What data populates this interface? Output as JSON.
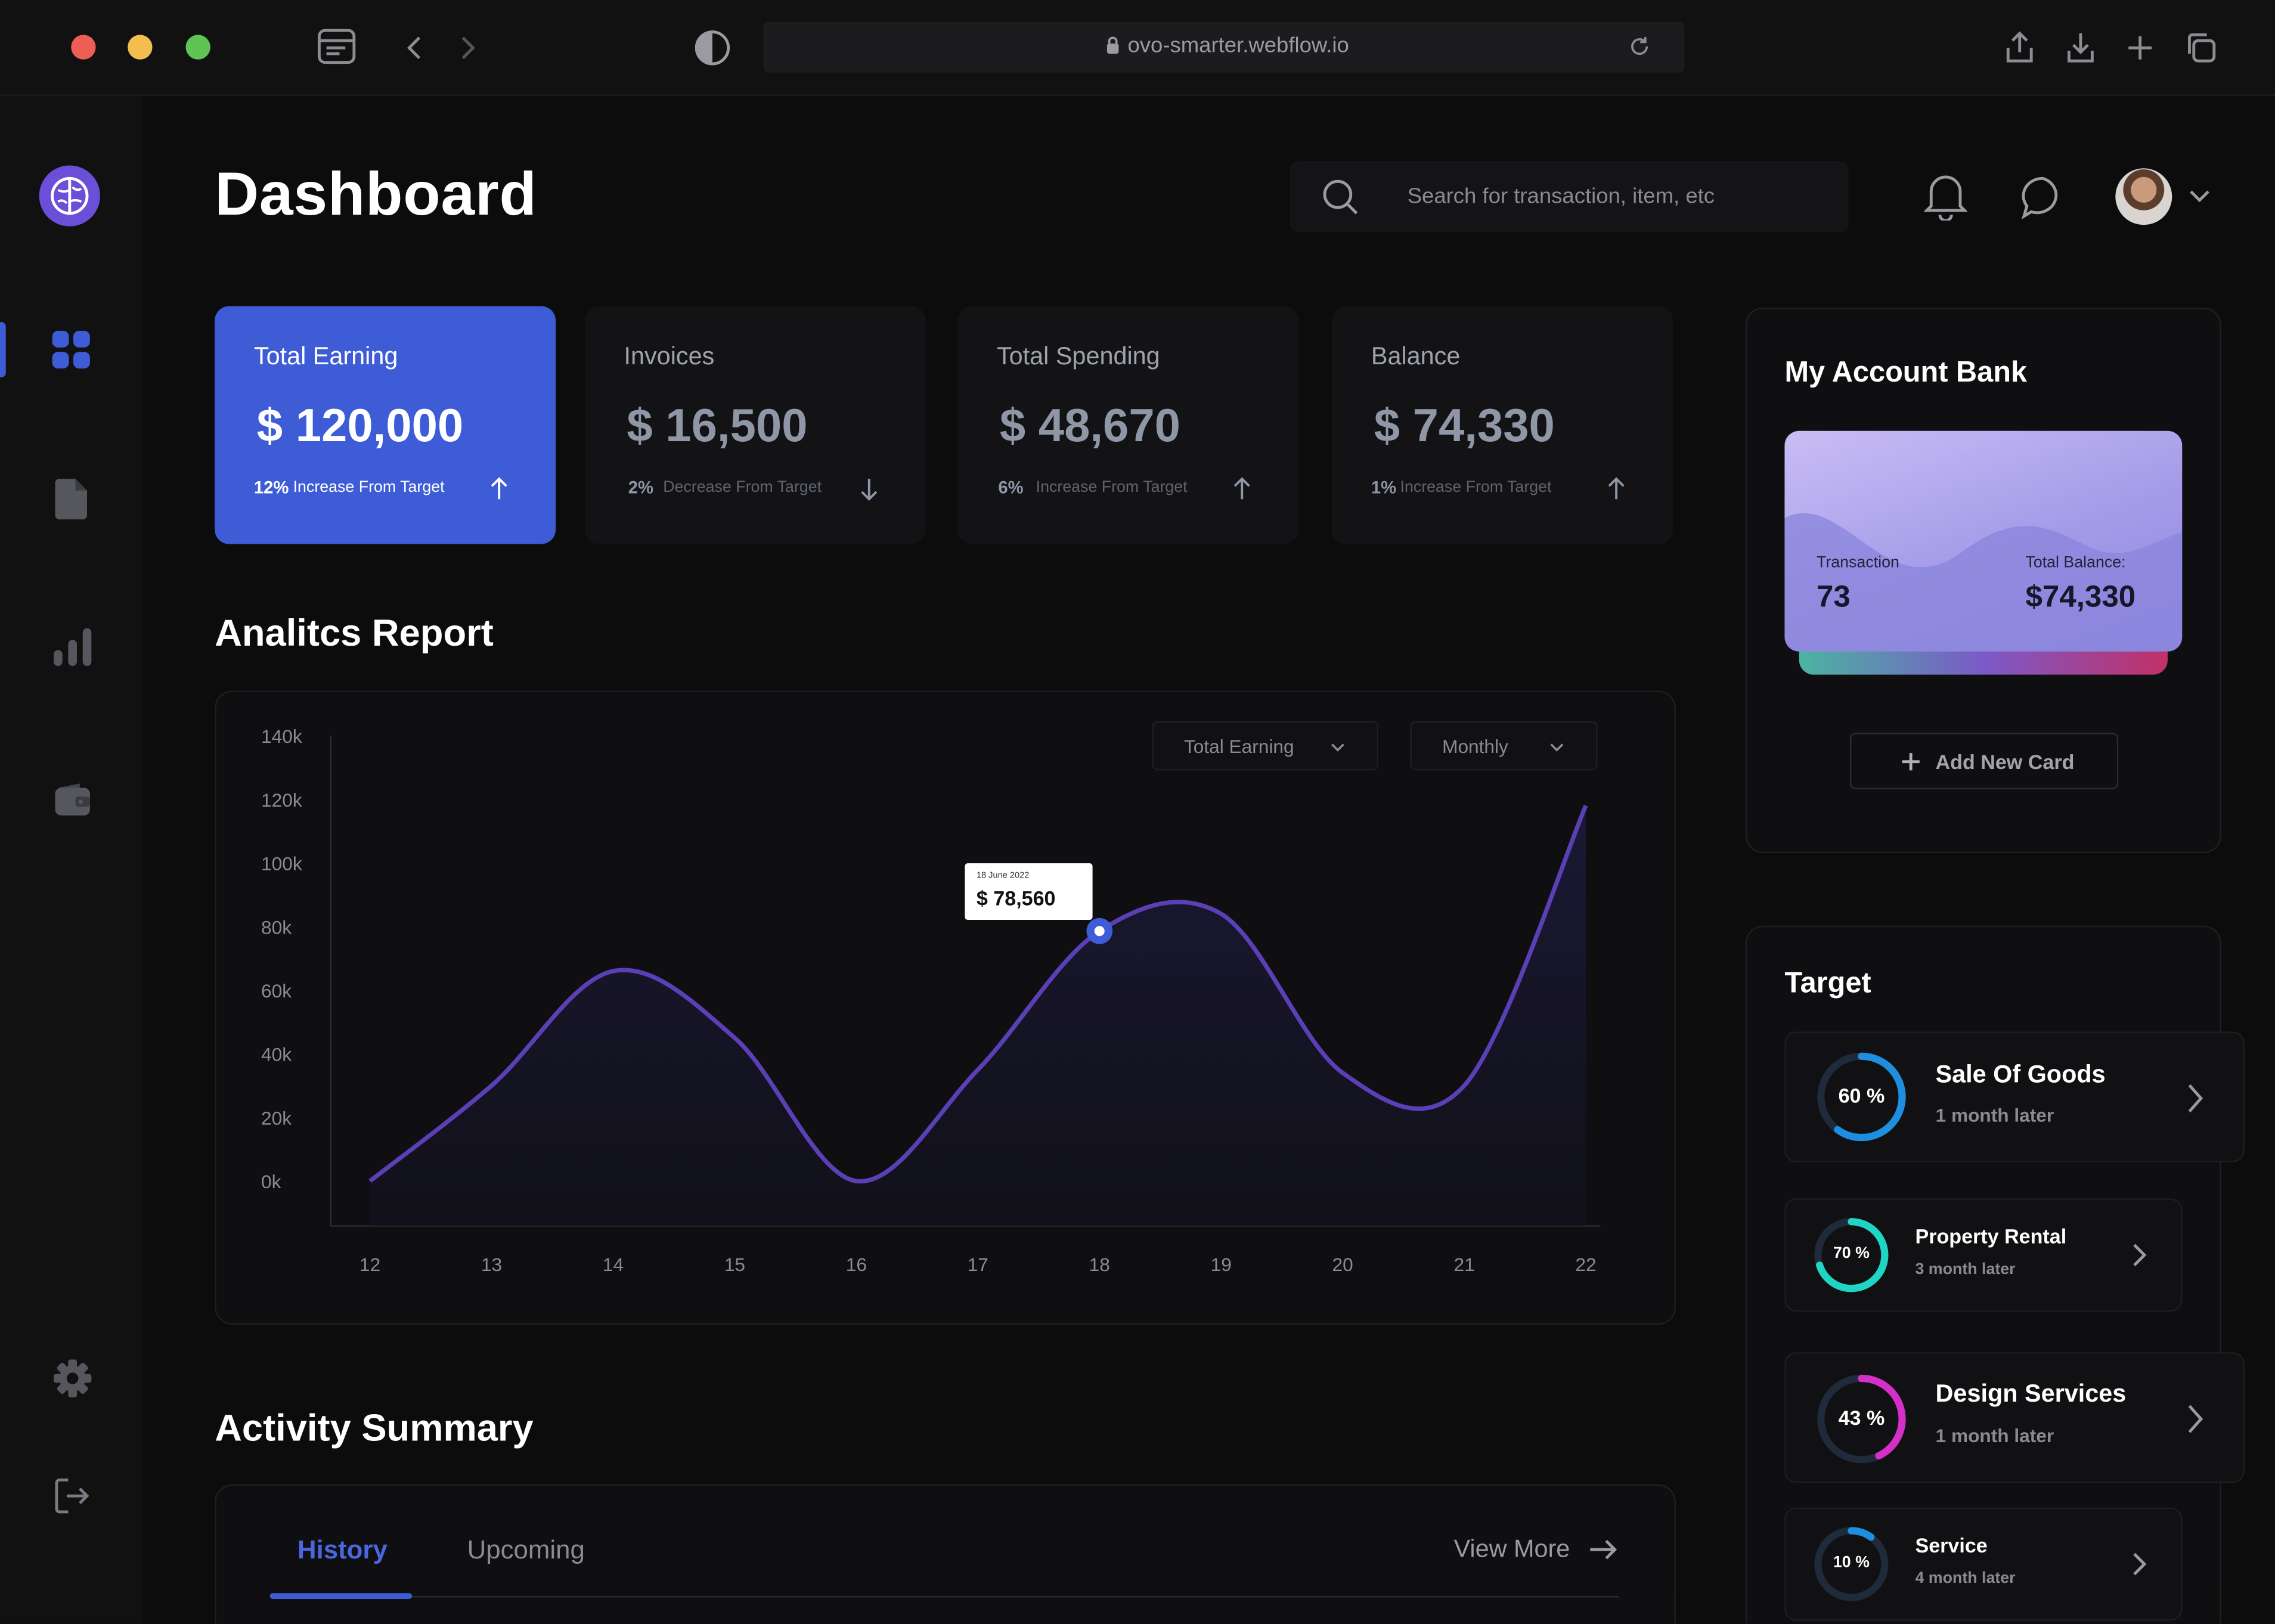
{
  "browser": {
    "url": "ovo-smarter.webflow.io"
  },
  "header": {
    "title": "Dashboard",
    "search_placeholder": "Search for transaction, item, etc"
  },
  "stats": [
    {
      "label": "Total Earning",
      "value": "$ 120,000",
      "pct": "12%",
      "note": "Increase From Target",
      "direction": "up"
    },
    {
      "label": "Invoices",
      "value": "$ 16,500",
      "pct": "2%",
      "note": "Decrease From Target",
      "direction": "down"
    },
    {
      "label": "Total Spending",
      "value": "$ 48,670",
      "pct": "6%",
      "note": "Increase From Target",
      "direction": "up"
    },
    {
      "label": "Balance",
      "value": "$ 74,330",
      "pct": "1%",
      "note": "Increase From Target",
      "direction": "up"
    }
  ],
  "analytics": {
    "title": "Analitcs Report",
    "metric_dropdown": "Total Earning",
    "period_dropdown": "Monthly",
    "tooltip": {
      "date": "18 June 2022",
      "value": "$ 78,560"
    }
  },
  "chart_data": {
    "type": "area",
    "x": [
      12,
      13,
      14,
      15,
      16,
      17,
      18,
      19,
      20,
      21,
      22
    ],
    "values": [
      0,
      30000,
      66000,
      45000,
      0,
      35000,
      78560,
      84000,
      34000,
      30000,
      118000
    ],
    "y_ticks": [
      "140k",
      "120k",
      "100k",
      "80k",
      "60k",
      "40k",
      "20k",
      "0k"
    ],
    "ylim": [
      0,
      140000
    ],
    "series_color": "#5b3fb6",
    "highlight": {
      "x": 18,
      "value": 78560
    }
  },
  "activity": {
    "title": "Activity Summary",
    "tabs": [
      "History",
      "Upcoming"
    ],
    "active_tab": "History",
    "view_more": "View More"
  },
  "bank": {
    "title": "My Account Bank",
    "transaction_label": "Transaction",
    "transaction_value": "73",
    "balance_label": "Total Balance:",
    "balance_value": "$74,330",
    "add_button": "Add New Card"
  },
  "target": {
    "title": "Target",
    "items": [
      {
        "name": "Sale Of Goods",
        "sub": "1 month later",
        "pct": "60 %",
        "progress": 0.6,
        "color": "#1e8fe0"
      },
      {
        "name": "Property Rental",
        "sub": "3 month later",
        "pct": "70 %",
        "progress": 0.7,
        "color": "#1fd6c4"
      },
      {
        "name": "Design Services",
        "sub": "1 month later",
        "pct": "43 %",
        "progress": 0.43,
        "color": "#d42fc7"
      },
      {
        "name": "Service",
        "sub": "4 month later",
        "pct": "10 %",
        "progress": 0.1,
        "color": "#1e8fe0"
      }
    ]
  },
  "colors": {
    "accent": "#3d5cd6",
    "background": "#0c0c0d",
    "panel": "#0f0f11"
  }
}
